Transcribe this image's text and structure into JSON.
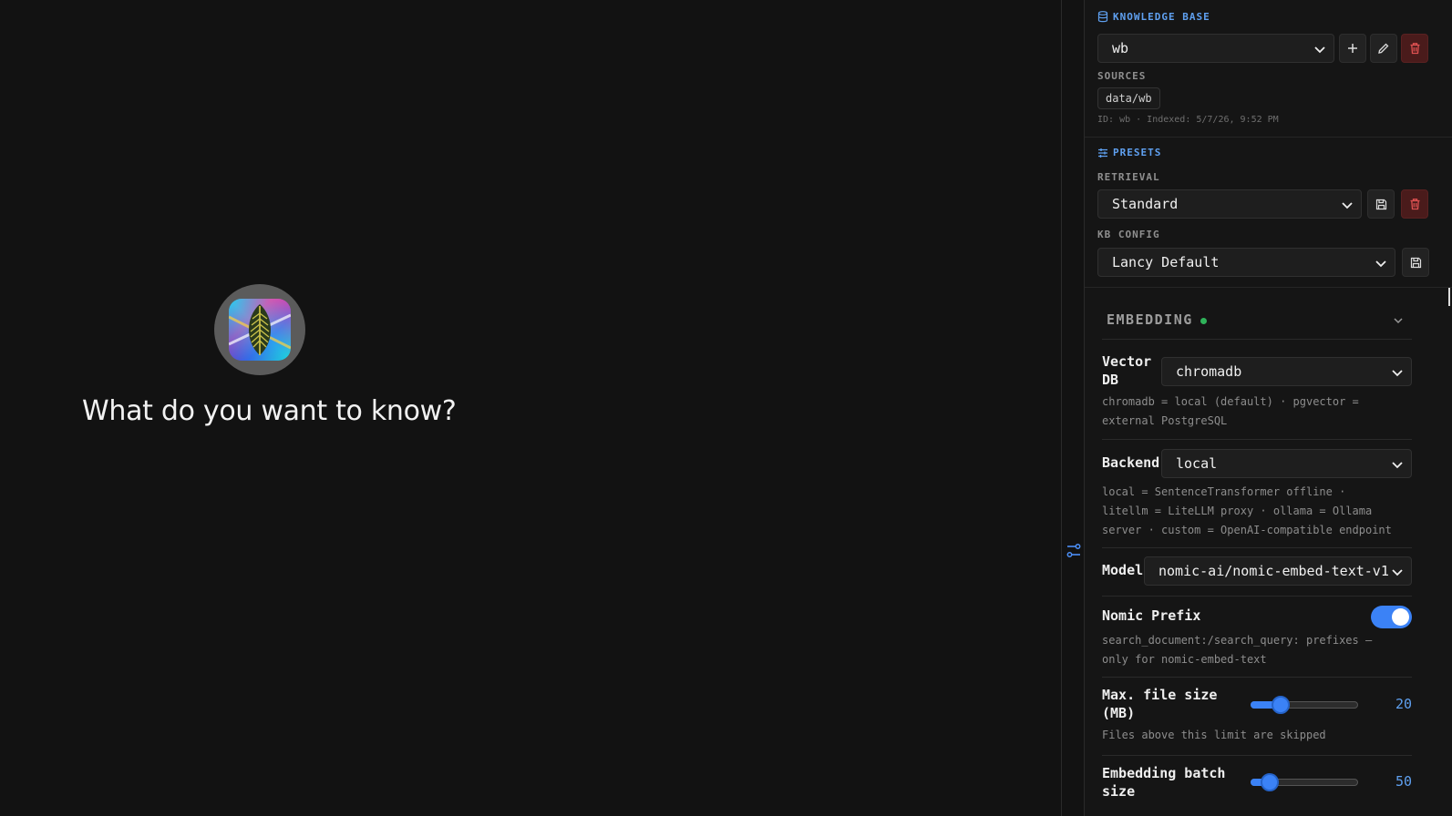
{
  "chat": {
    "prompt_title": "What do you want to know?"
  },
  "knowledge_base": {
    "heading": "KNOWLEDGE BASE",
    "selected": "wb",
    "sources_label": "SOURCES",
    "sources": [
      "data/wb"
    ],
    "meta": "ID: wb · Indexed: 5/7/26, 9:52 PM"
  },
  "presets": {
    "heading": "PRESETS",
    "retrieval_label": "RETRIEVAL",
    "retrieval_selected": "Standard",
    "kb_config_label": "KB CONFIG",
    "kb_config_selected": "Lancy Default"
  },
  "embedding": {
    "heading": "EMBEDDING",
    "status_color": "#2fb35a",
    "vector_db": {
      "label_line1": "Vector",
      "label_line2": "DB",
      "value": "chromadb",
      "help_line1": "chromadb = local (default) · pgvector =",
      "help_line2": "external PostgreSQL"
    },
    "backend": {
      "label": "Backend",
      "value": "local",
      "help_line1": "local = SentenceTransformer offline ·",
      "help_line2": "litellm = LiteLLM proxy · ollama = Ollama",
      "help_line3": "server · custom = OpenAI-compatible endpoint"
    },
    "model": {
      "label": "Model",
      "value": "nomic-ai/nomic-embed-text-v1"
    },
    "nomic_prefix": {
      "label": "Nomic Prefix",
      "enabled": true,
      "help_line1": "search_document:/search_query: prefixes —",
      "help_line2": "only for nomic-embed-text"
    },
    "max_file_size": {
      "label_line1": "Max. file size",
      "label_line2": "(MB)",
      "value": "20",
      "fraction": 0.23,
      "help": "Files above this limit are skipped"
    },
    "batch_size": {
      "label_line1": "Embedding batch",
      "label_line2": "size",
      "value": "50",
      "fraction": 0.11
    }
  },
  "colors": {
    "accent": "#3b82f6",
    "heading_blue": "#5fa0f0",
    "danger": "#e05252"
  }
}
